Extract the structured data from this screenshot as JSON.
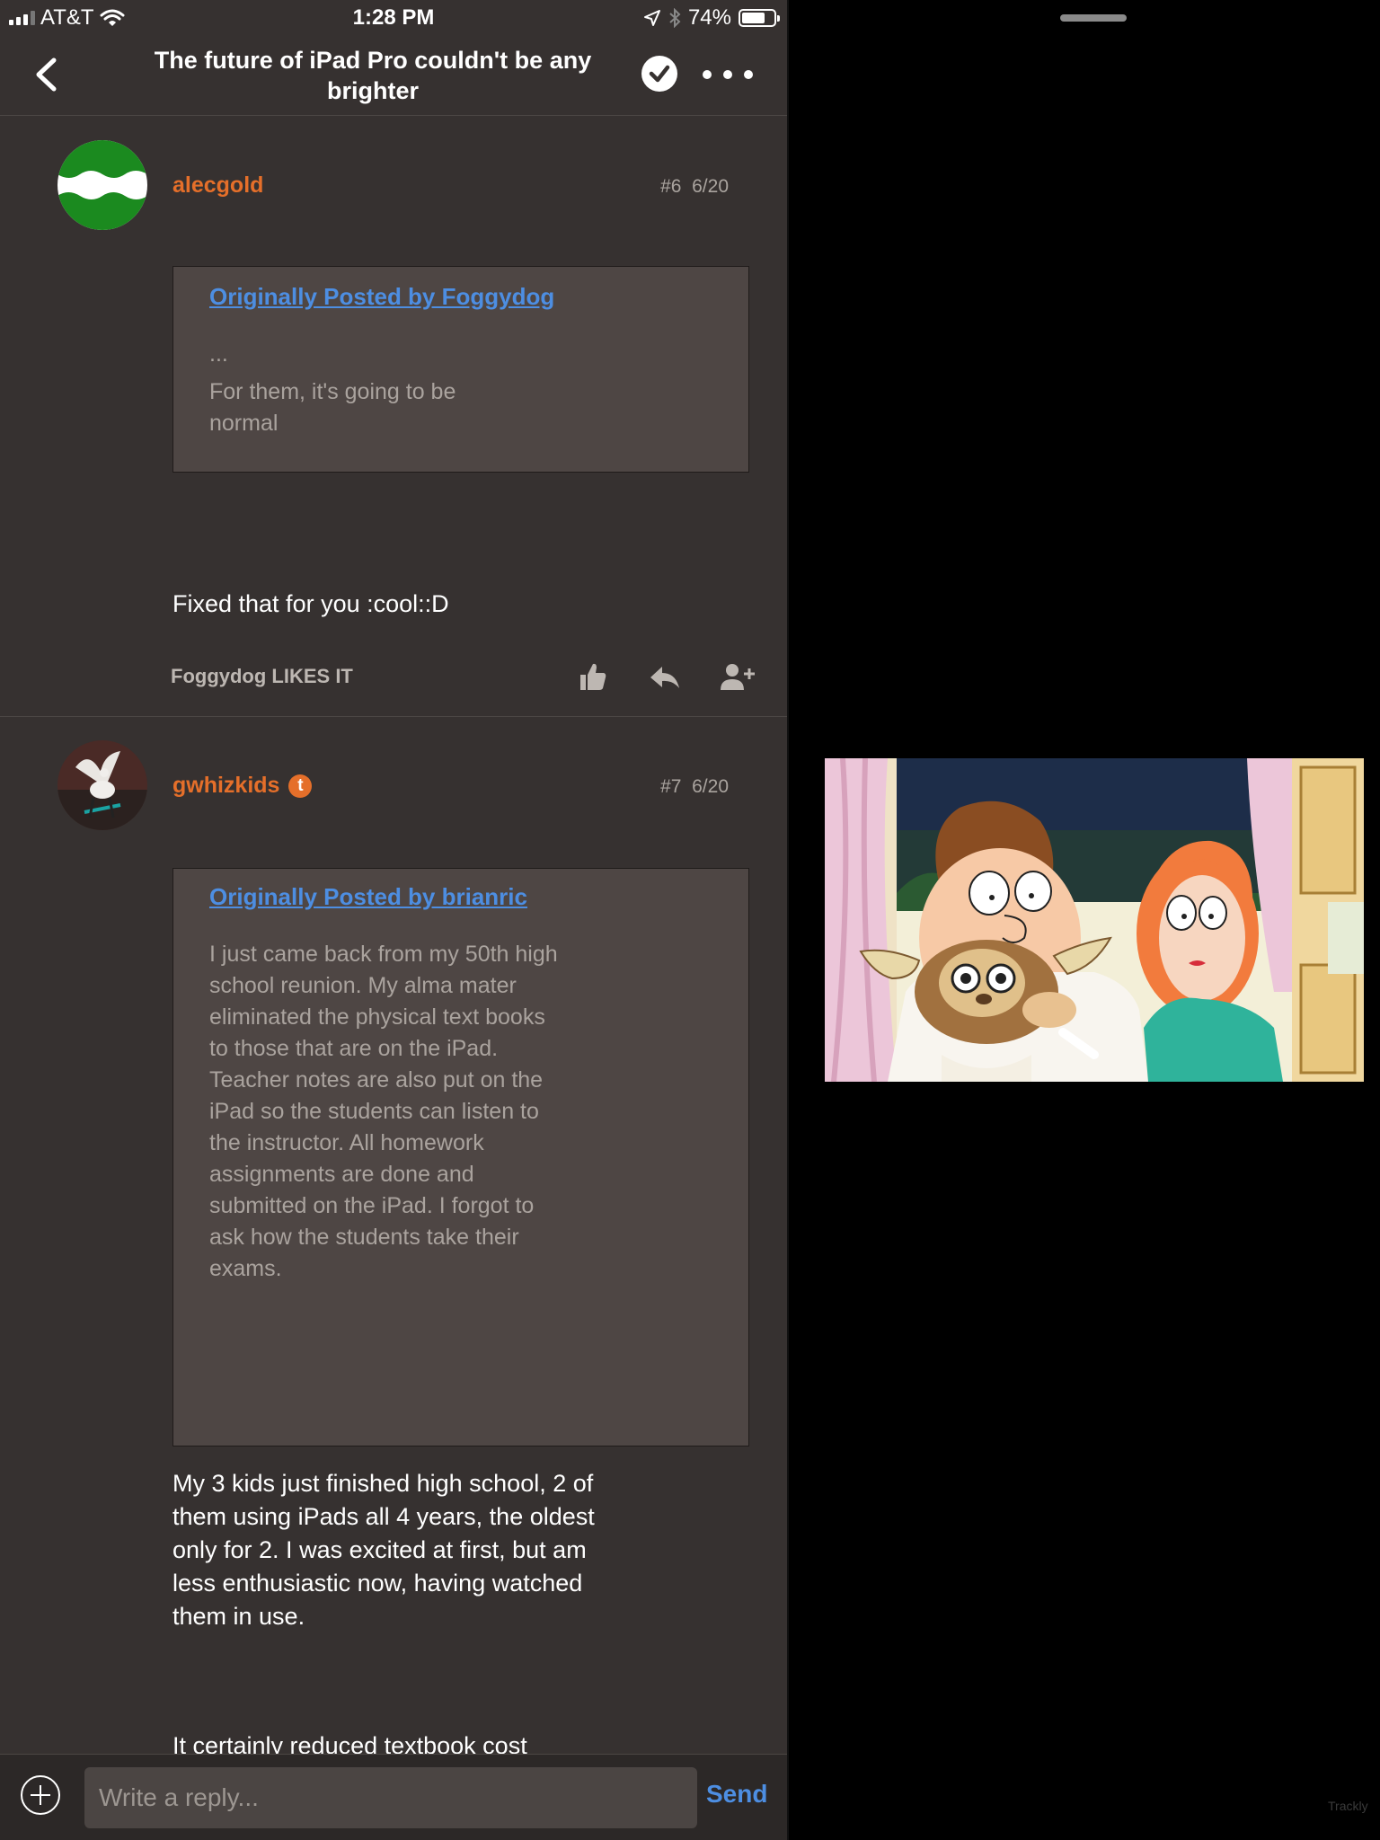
{
  "status_bar": {
    "carrier": "AT&T",
    "time": "1:28 PM",
    "battery_pct": "74%",
    "battery_level": 0.74
  },
  "nav": {
    "title": "The future of iPad Pro couldn't be any brighter"
  },
  "posts": [
    {
      "username": "alecgold",
      "number": "#6",
      "date": "6/20",
      "quote": {
        "link": "Originally Posted by Foggydog",
        "lines": [
          "...",
          "For them, it's going to be normal"
        ]
      },
      "body": [
        "Fixed that for you :cool::D"
      ],
      "likes": "Foggydog LIKES IT"
    },
    {
      "username": "gwhizkids",
      "badge": "t",
      "number": "#7",
      "date": "6/20",
      "quote": {
        "link": "Originally Posted by brianric",
        "lines": [
          "I just came back from my 50th high school reunion. My alma mater eliminated the physical text books to those that are on the iPad. Teacher notes are also put on the iPad so the students can listen to the instructor. All homework assignments are done and submitted on the iPad. I forgot to ask how the students take their exams."
        ]
      },
      "body": [
        "My 3 kids just finished high school, 2 of them using iPads all 4 years, the oldest only for 2. I was excited at first, but am less enthusiastic now, having watched them in use.",
        "It certainly reduced textbook cost dramatically and was less wear and tear on the kids hauling heavy books. But the ease of use was just not there. For math and science, in"
      ]
    }
  ],
  "reply": {
    "placeholder": "Write a reply...",
    "send_label": "Send"
  },
  "watermark": "Trackly",
  "colors": {
    "background": "#363130",
    "username": "#e56f2a",
    "link": "#4d8ee2",
    "quote_bg": "#4e4644"
  }
}
